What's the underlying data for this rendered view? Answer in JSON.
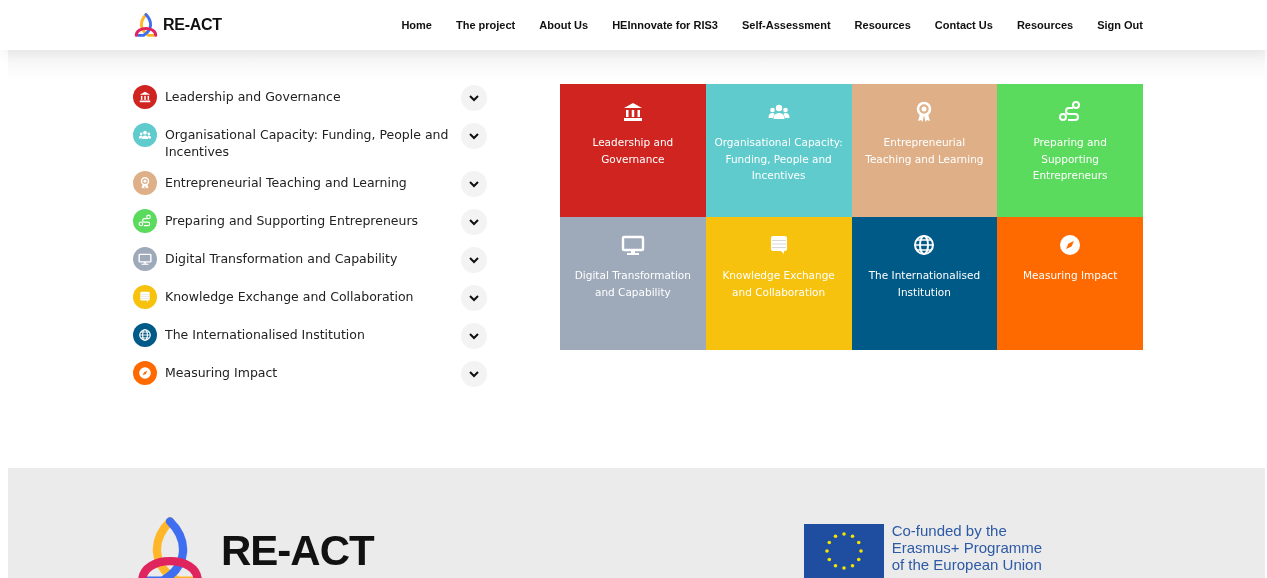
{
  "header": {
    "logo_text": "RE-ACT",
    "nav": [
      {
        "label": "Home"
      },
      {
        "label": "The project"
      },
      {
        "label": "About Us"
      },
      {
        "label": "HEInnovate for RIS3"
      },
      {
        "label": "Self-Assessment"
      },
      {
        "label": "Resources"
      },
      {
        "label": "Contact Us"
      },
      {
        "label": "Resources"
      },
      {
        "label": "Sign Out"
      }
    ]
  },
  "accordion": [
    {
      "label": "Leadership and Governance",
      "color": "#cf2420",
      "expanded": false
    },
    {
      "label": "Organisational Capacity: Funding, People and Incentives",
      "color": "#5fcbcc",
      "expanded": false
    },
    {
      "label": "Entrepreneurial Teaching and Learning",
      "color": "#dfb087",
      "expanded": false
    },
    {
      "label": "Preparing and Supporting Entrepreneurs",
      "color": "#5bdb5d",
      "expanded": false
    },
    {
      "label": "Digital Transformation and Capability",
      "color": "#9eaaba",
      "expanded": false
    },
    {
      "label": "Knowledge Exchange and Collaboration",
      "color": "#f6c20e",
      "expanded": false
    },
    {
      "label": "The Internationalised Institution",
      "color": "#005a87",
      "expanded": false
    },
    {
      "label": "Measuring Impact",
      "color": "#ff6a00",
      "expanded": false
    }
  ],
  "tiles": [
    {
      "label": "Leadership and Governance",
      "color": "#cf2420"
    },
    {
      "label": "Organisational Capacity: Funding, People and Incentives",
      "color": "#5fcbcc"
    },
    {
      "label": "Entrepreneurial Teaching and Learning",
      "color": "#dfb087"
    },
    {
      "label": "Preparing and Supporting Entrepreneurs",
      "color": "#5bdb5d"
    },
    {
      "label": "Digital Transformation and Capability",
      "color": "#9eaaba"
    },
    {
      "label": "Knowledge Exchange and Collaboration",
      "color": "#f6c20e"
    },
    {
      "label": "The Internationalised Institution",
      "color": "#005a87"
    },
    {
      "label": "Measuring Impact",
      "color": "#ff6a00"
    }
  ],
  "footer": {
    "logo_text": "RE-ACT",
    "eu_text": "Co-funded by the Erasmus+ Programme of the European Union"
  }
}
